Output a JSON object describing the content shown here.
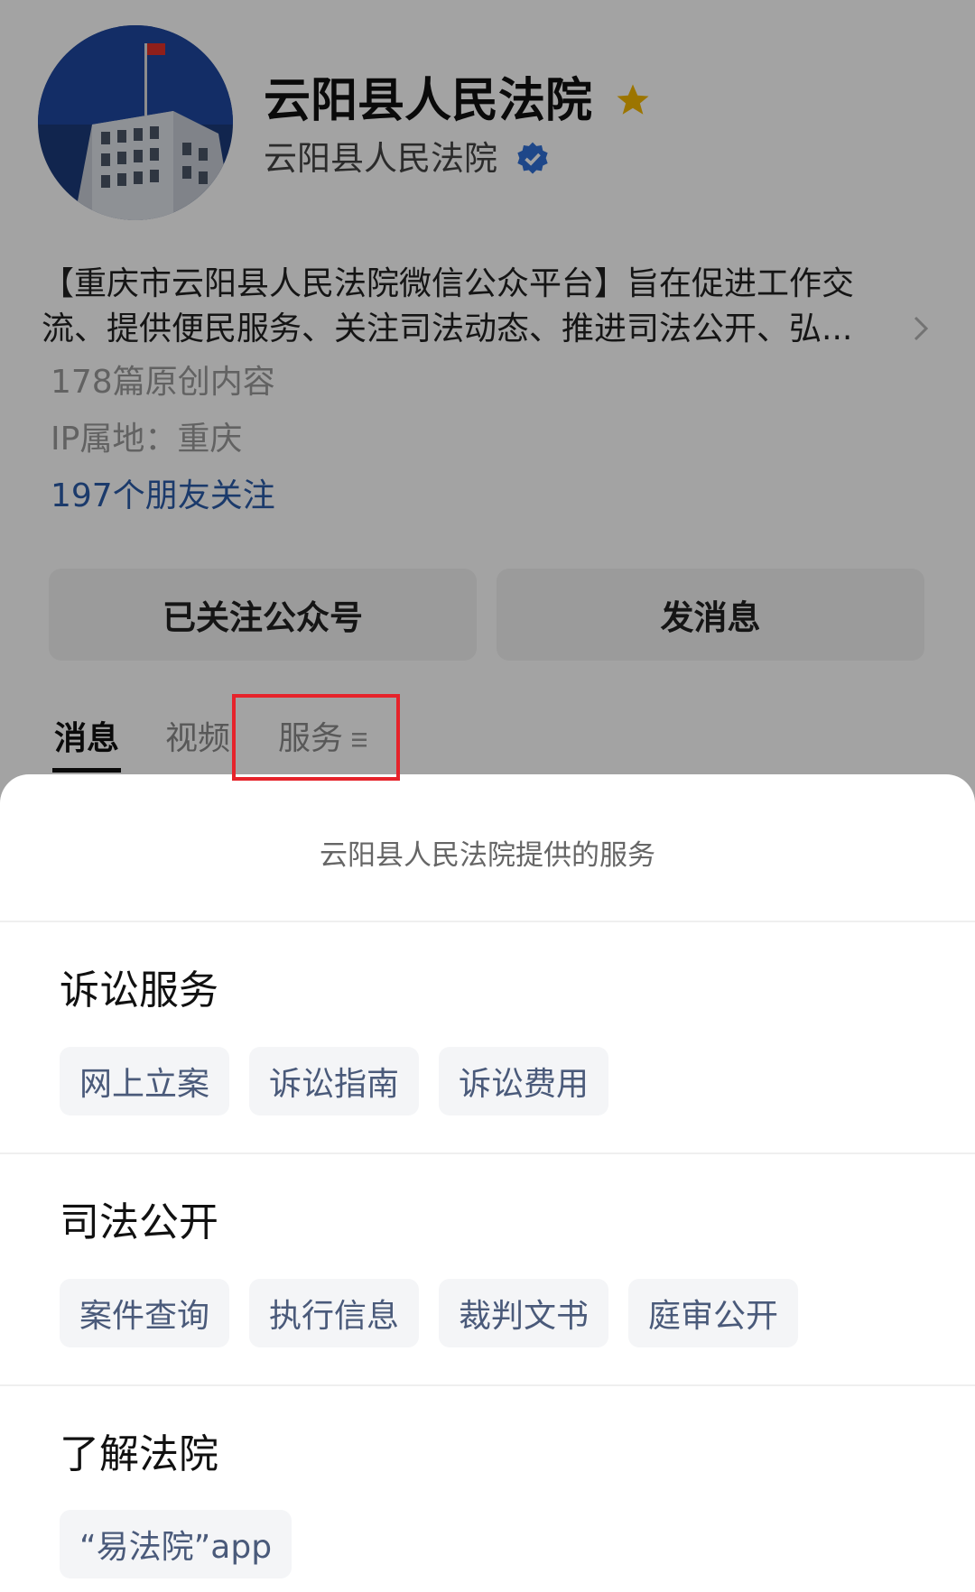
{
  "profile": {
    "name": "云阳县人民法院",
    "subname": "云阳县人民法院",
    "description_line1": "【重庆市云阳县人民法院微信公众平台】旨在促进工作交",
    "description_line2": "流、提供便民服务、关注司法动态、推进司法公开、弘...",
    "original_count": "178篇原创内容",
    "ip_location": "IP属地：重庆",
    "friends_following": "197个朋友关注"
  },
  "buttons": {
    "follow": "已关注公众号",
    "message": "发消息"
  },
  "tabs": [
    {
      "label": "消息",
      "active": true
    },
    {
      "label": "视频",
      "active": false
    },
    {
      "label": "服务",
      "active": false
    }
  ],
  "sheet": {
    "title": "云阳县人民法院提供的服务",
    "sections": [
      {
        "title": "诉讼服务",
        "items": [
          "网上立案",
          "诉讼指南",
          "诉讼费用"
        ]
      },
      {
        "title": "司法公开",
        "items": [
          "案件查询",
          "执行信息",
          "裁判文书",
          "庭审公开"
        ]
      },
      {
        "title": "了解法院",
        "items": [
          "“易法院”app"
        ]
      }
    ]
  },
  "icons": {
    "star": "star-icon",
    "verified": "verified-icon",
    "chevron": "chevron-right-icon",
    "menu": "menu-icon"
  },
  "colors": {
    "star": "#f5b800",
    "verified": "#2f6fd6",
    "link": "#2b5ca8",
    "highlight": "#e6232b",
    "chip_text": "#4a5a7a"
  }
}
